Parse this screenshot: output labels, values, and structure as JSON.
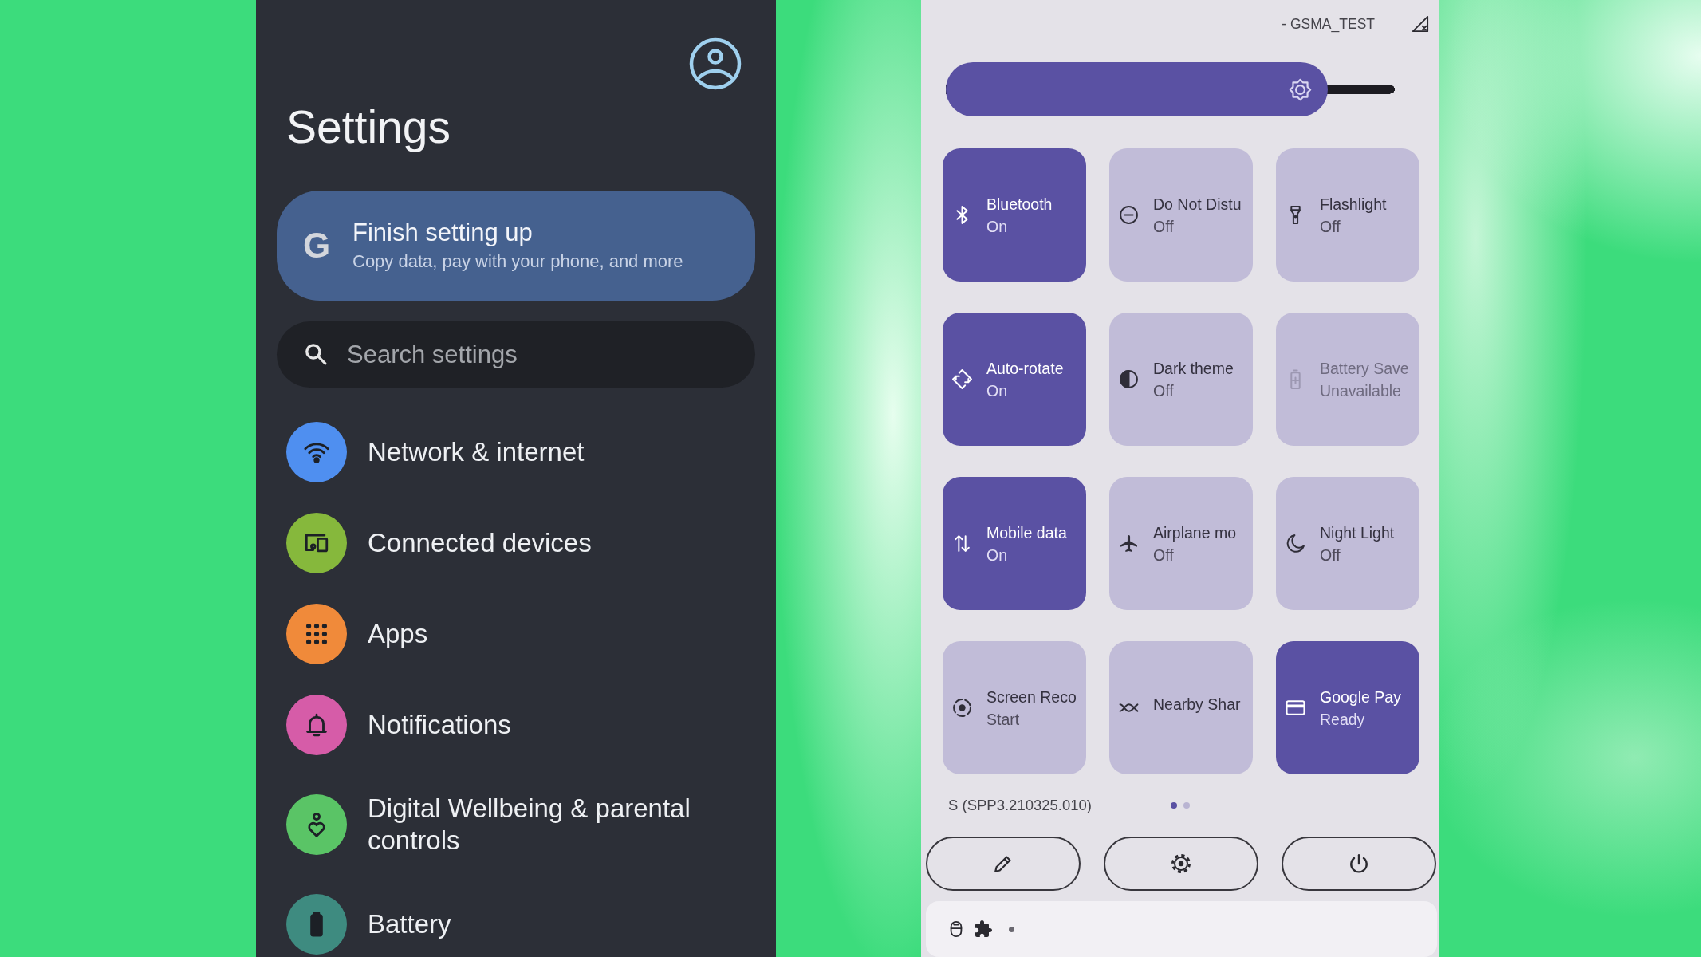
{
  "settings": {
    "title": "Settings",
    "setup_card": {
      "logo": "G",
      "title": "Finish setting up",
      "subtitle": "Copy data, pay with your phone, and more"
    },
    "search": {
      "placeholder": "Search settings"
    },
    "items": [
      {
        "label": "Network & internet",
        "color": "#4f8ff0"
      },
      {
        "label": "Connected devices",
        "color": "#86b83c"
      },
      {
        "label": "Apps",
        "color": "#f08a3a"
      },
      {
        "label": "Notifications",
        "color": "#d65ca8"
      },
      {
        "label": "Digital Wellbeing & parental controls",
        "color": "#5ac466"
      },
      {
        "label": "Battery",
        "color": "#3e8b80"
      }
    ]
  },
  "quick_settings": {
    "carrier": "- GSMA_TEST",
    "brightness": {
      "level": 0.85
    },
    "tiles": [
      {
        "label": "Bluetooth",
        "status": "On",
        "on": true,
        "disabled": false
      },
      {
        "label": "Do Not Distu",
        "status": "Off",
        "on": false,
        "disabled": false
      },
      {
        "label": "Flashlight",
        "status": "Off",
        "on": false,
        "disabled": false
      },
      {
        "label": "Auto-rotate",
        "status": "On",
        "on": true,
        "disabled": false
      },
      {
        "label": "Dark theme",
        "status": "Off",
        "on": false,
        "disabled": false
      },
      {
        "label": "Battery Save",
        "status": "Unavailable",
        "on": false,
        "disabled": true
      },
      {
        "label": "Mobile data",
        "status": "On",
        "on": true,
        "disabled": false
      },
      {
        "label": "Airplane mo",
        "status": "Off",
        "on": false,
        "disabled": false
      },
      {
        "label": "Night Light",
        "status": "Off",
        "on": false,
        "disabled": false
      },
      {
        "label": "Screen Reco",
        "status": "Start",
        "on": false,
        "disabled": false
      },
      {
        "label": "Nearby Shar",
        "on": false,
        "disabled": false
      },
      {
        "label": "Google Pay",
        "status": "Ready",
        "on": true,
        "disabled": false
      }
    ],
    "build": "S (SPP3.210325.010)",
    "pages": [
      {
        "selected": true
      },
      {
        "selected": false
      }
    ]
  }
}
